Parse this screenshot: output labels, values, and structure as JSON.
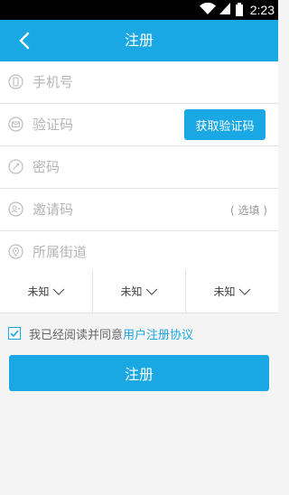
{
  "status_bar": {
    "time": "2:23"
  },
  "header": {
    "title": "注册"
  },
  "form": {
    "phone_placeholder": "手机号",
    "code_placeholder": "验证码",
    "get_code_label": "获取验证码",
    "password_placeholder": "密码",
    "invite_placeholder": "邀请码",
    "invite_optional": "( 选填 )",
    "street_placeholder": "所属街道"
  },
  "selects": [
    {
      "value": "未知"
    },
    {
      "value": "未知"
    },
    {
      "value": "未知"
    }
  ],
  "agreement": {
    "checked": true,
    "text": "我已经阅读并同意",
    "link": "用户注册协议"
  },
  "submit_label": "注册",
  "colors": {
    "accent": "#1aa8e4",
    "icon": "#bdbdbd"
  }
}
